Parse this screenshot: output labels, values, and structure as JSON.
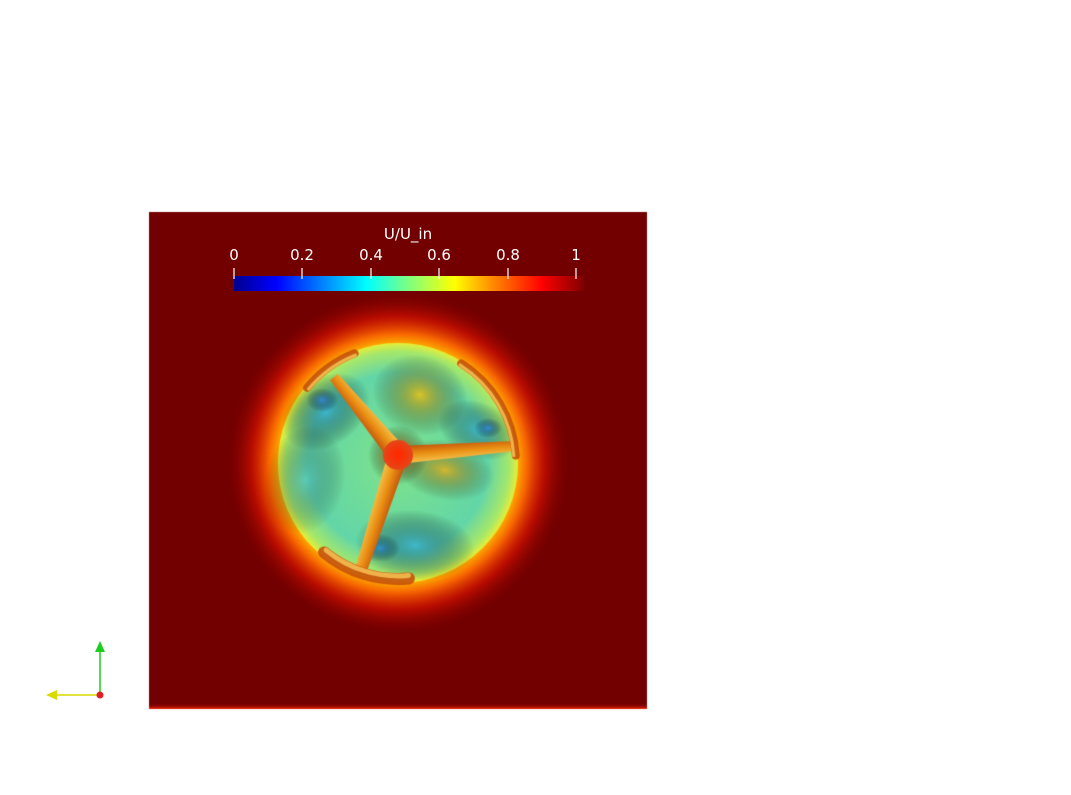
{
  "scalar_bar": {
    "title": "U/U_in",
    "ticks": [
      {
        "value": 0,
        "label": "0"
      },
      {
        "value": 0.2,
        "label": "0.2"
      },
      {
        "value": 0.4,
        "label": "0.4"
      },
      {
        "value": 0.6,
        "label": "0.6"
      },
      {
        "value": 0.8,
        "label": "0.8"
      },
      {
        "value": 1,
        "label": "1"
      }
    ],
    "range": [
      0,
      1
    ],
    "colormap": [
      "#00008f",
      "#0000ff",
      "#007fff",
      "#00ffff",
      "#7fff7f",
      "#ffff00",
      "#ff7f00",
      "#ff0000",
      "#7f0000"
    ]
  },
  "field_colors": {
    "background": "#720000",
    "rotor_disk": "#63d6a8",
    "wake_deficit": "#38b5d2",
    "hub": "#e4471a",
    "blade": "#e98f13"
  },
  "axes_colors": {
    "x": "#dada00",
    "y": "#1dcd1d",
    "z": "#e02020"
  }
}
